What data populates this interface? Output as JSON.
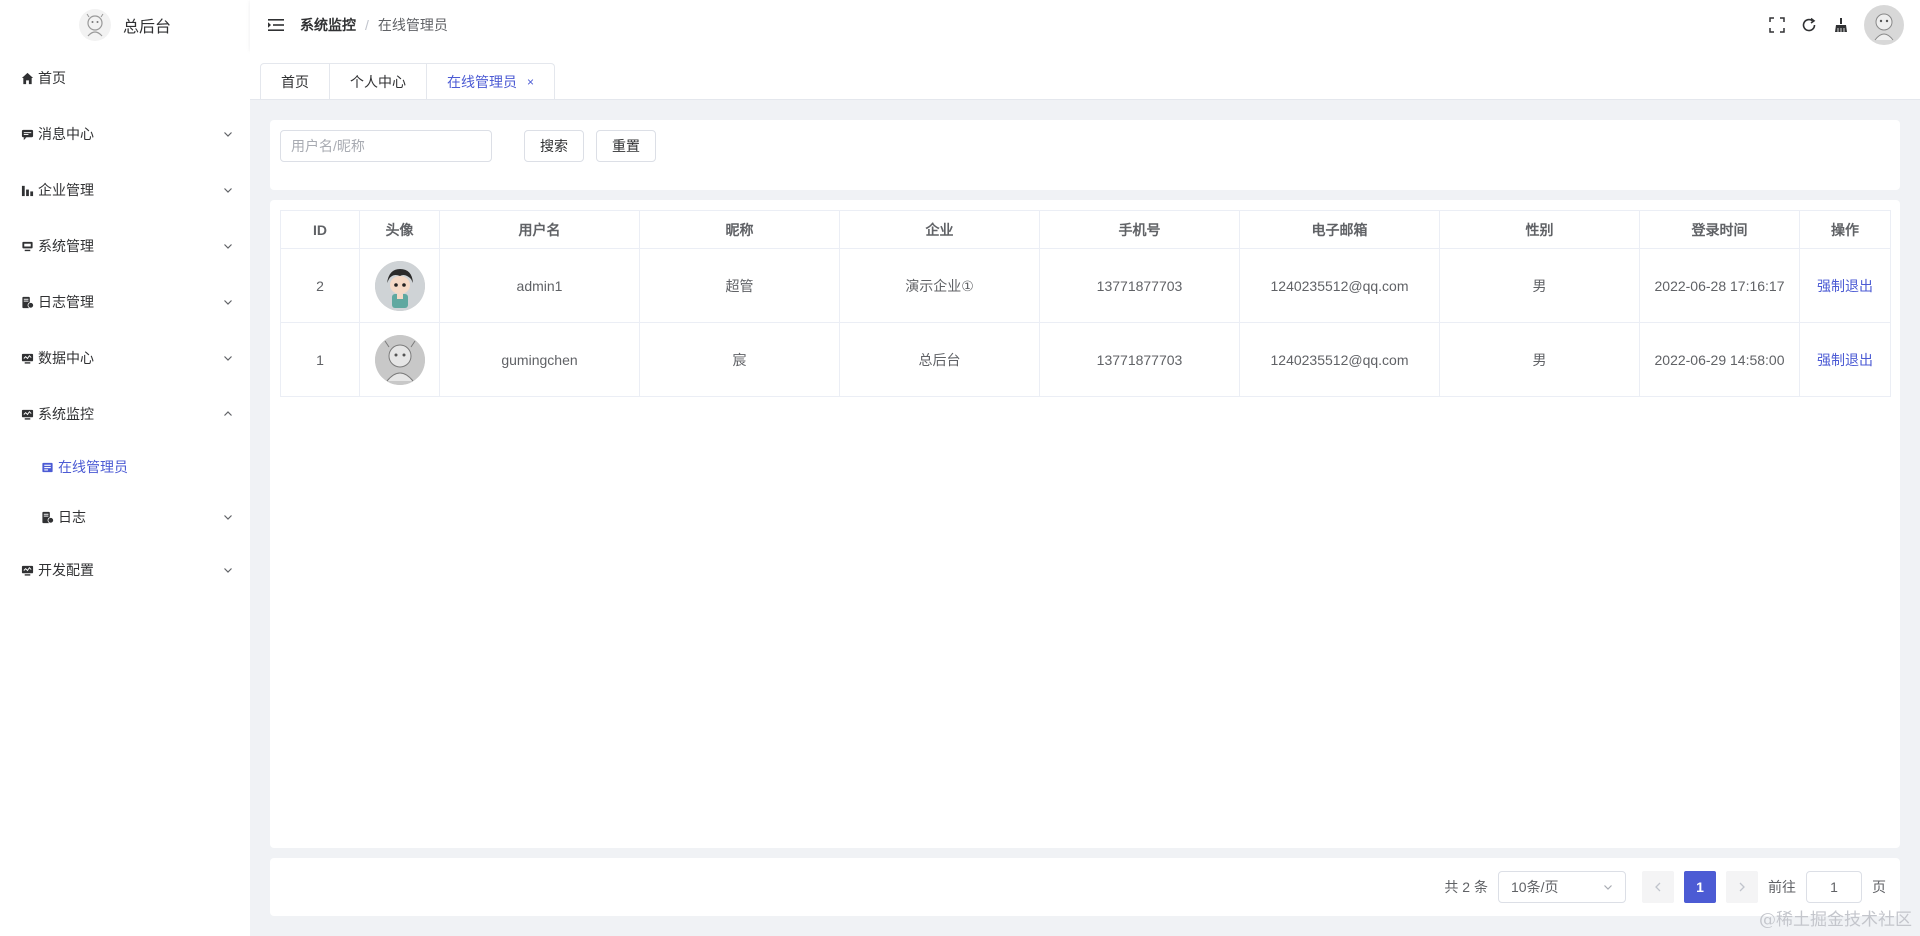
{
  "app": {
    "title": "总后台"
  },
  "sidebar": {
    "items": [
      {
        "label": "首页",
        "icon": "home-icon",
        "expandable": false
      },
      {
        "label": "消息中心",
        "icon": "message-icon",
        "expandable": true
      },
      {
        "label": "企业管理",
        "icon": "chart-icon",
        "expandable": true
      },
      {
        "label": "系统管理",
        "icon": "system-icon",
        "expandable": true
      },
      {
        "label": "日志管理",
        "icon": "log-icon",
        "expandable": true
      },
      {
        "label": "数据中心",
        "icon": "monitor-icon",
        "expandable": true
      },
      {
        "label": "系统监控",
        "icon": "monitor-icon",
        "expandable": true,
        "expanded": true
      },
      {
        "label": "在线管理员",
        "icon": "online-icon",
        "sub": true,
        "active": true
      },
      {
        "label": "日志",
        "icon": "log-icon",
        "sub": true,
        "expandable": true
      },
      {
        "label": "开发配置",
        "icon": "monitor-icon",
        "expandable": true
      }
    ]
  },
  "header": {
    "breadcrumb": {
      "parent": "系统监控",
      "separator": "/",
      "current": "在线管理员"
    }
  },
  "tags": {
    "items": [
      {
        "label": "首页"
      },
      {
        "label": "个人中心"
      },
      {
        "label": "在线管理员",
        "active": true,
        "close": "×"
      }
    ]
  },
  "search": {
    "placeholder": "用户名/昵称",
    "search_label": "搜索",
    "reset_label": "重置"
  },
  "table": {
    "columns": [
      "ID",
      "头像",
      "用户名",
      "昵称",
      "企业",
      "手机号",
      "电子邮箱",
      "性别",
      "登录时间",
      "操作"
    ],
    "rows": [
      {
        "id": "2",
        "username": "admin1",
        "nickname": "超管",
        "company": "演示企业①",
        "phone": "13771877703",
        "email": "1240235512@qq.com",
        "gender": "男",
        "login_time": "2022-06-28 17:16:17",
        "action": "强制退出"
      },
      {
        "id": "1",
        "username": "gumingchen",
        "nickname": "宸",
        "company": "总后台",
        "phone": "13771877703",
        "email": "1240235512@qq.com",
        "gender": "男",
        "login_time": "2022-06-29 14:58:00",
        "action": "强制退出"
      }
    ]
  },
  "pagination": {
    "total_text": "共 2 条",
    "page_size": "10条/页",
    "current_page": "1",
    "goto_label": "前往",
    "goto_value": "1",
    "page_unit": "页"
  },
  "watermark": "@稀土掘金技术社区",
  "colors": {
    "primary": "#4c5bd4",
    "border": "#ebeef5",
    "background": "#f0f2f5"
  }
}
